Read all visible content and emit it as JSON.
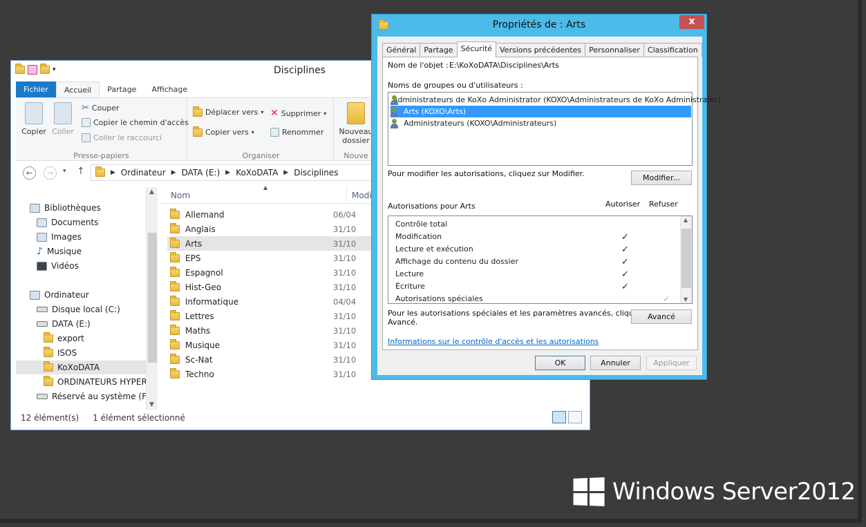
{
  "explorer": {
    "title": "Disciplines",
    "ribbon_tabs": [
      "Fichier",
      "Accueil",
      "Partage",
      "Affichage"
    ],
    "clipboard": {
      "copy": "Copier",
      "paste": "Coller",
      "cut": "Couper",
      "copy_path": "Copier le chemin d'accès",
      "paste_shortcut": "Coller le raccourci",
      "group": "Presse-papiers"
    },
    "organize": {
      "move_to": "Déplacer vers",
      "copy_to": "Copier vers",
      "delete": "Supprimer",
      "rename": "Renommer",
      "group": "Organiser"
    },
    "new": {
      "new_folder_line1": "Nouveau",
      "new_folder_line2": "dossier",
      "group": "Nouve"
    },
    "breadcrumb": [
      "Ordinateur",
      "DATA (E:)",
      "KoXoDATA",
      "Disciplines"
    ],
    "nav": [
      {
        "label": "Bibliothèques",
        "icon": "libraries-icon"
      },
      {
        "label": "Documents",
        "icon": "documents-icon"
      },
      {
        "label": "Images",
        "icon": "pictures-icon"
      },
      {
        "label": "Musique",
        "icon": "music-icon"
      },
      {
        "label": "Vidéos",
        "icon": "videos-icon"
      },
      {
        "label": "Ordinateur",
        "icon": "computer-icon"
      },
      {
        "label": "Disque local (C:)",
        "icon": "drive-icon"
      },
      {
        "label": "DATA (E:)",
        "icon": "drive-icon"
      },
      {
        "label": "export",
        "icon": "folder-icon"
      },
      {
        "label": "ISOS",
        "icon": "folder-icon"
      },
      {
        "label": "KoXoDATA",
        "icon": "folder-icon"
      },
      {
        "label": "ORDINATEURS HYPER-V",
        "icon": "folder-icon"
      },
      {
        "label": "Réservé au système (F:)",
        "icon": "drive-icon"
      }
    ],
    "columns": {
      "name": "Nom",
      "modified": "Modi"
    },
    "files": [
      {
        "name": "Allemand",
        "date": "06/04"
      },
      {
        "name": "Anglais",
        "date": "31/10"
      },
      {
        "name": "Arts",
        "date": "31/10"
      },
      {
        "name": "EPS",
        "date": "31/10"
      },
      {
        "name": "Espagnol",
        "date": "31/10"
      },
      {
        "name": "Hist-Geo",
        "date": "31/10"
      },
      {
        "name": "Informatique",
        "date": "04/04"
      },
      {
        "name": "Lettres",
        "date": "31/10"
      },
      {
        "name": "Maths",
        "date": "31/10"
      },
      {
        "name": "Musique",
        "date": "31/10"
      },
      {
        "name": "Sc-Nat",
        "date": "31/10"
      },
      {
        "name": "Techno",
        "date": "31/10"
      }
    ],
    "status": {
      "count": "12 élément(s)",
      "selected": "1 élément sélectionné"
    }
  },
  "dialog": {
    "title": "Propriétés de : Arts",
    "close": "x",
    "tabs": [
      "Général",
      "Partage",
      "Sécurité",
      "Versions précédentes",
      "Personnaliser",
      "Classification"
    ],
    "object_label": "Nom de l'objet :",
    "object_value": "E:\\KoXoDATA\\Disciplines\\Arts",
    "groups_label": "Noms de groupes ou d'utilisateurs :",
    "users": [
      "Administrateurs de KoXo Administrator (KOXO\\Administrateurs de KoXo Administrator)",
      "Arts (KOXO\\Arts)",
      "Administrateurs (KOXO\\Administrateurs)"
    ],
    "modify_hint": "Pour modifier les autorisations, cliquez sur Modifier.",
    "modify_button": "Modifier...",
    "perms_label": "Autorisations pour Arts",
    "allow_label": "Autoriser",
    "deny_label": "Refuser",
    "permissions": [
      {
        "name": "Contrôle total",
        "allow": "",
        "deny": ""
      },
      {
        "name": "Modification",
        "allow": "✓",
        "deny": ""
      },
      {
        "name": "Lecture et exécution",
        "allow": "✓",
        "deny": ""
      },
      {
        "name": "Affichage du contenu du dossier",
        "allow": "✓",
        "deny": ""
      },
      {
        "name": "Lecture",
        "allow": "✓",
        "deny": ""
      },
      {
        "name": "Écriture",
        "allow": "✓",
        "deny": ""
      },
      {
        "name": "Autorisations spéciales",
        "allow": "",
        "deny": "✓"
      }
    ],
    "advanced_hint_line1": "Pour les autorisations spéciales et les paramètres avancés, cliquez sur",
    "advanced_hint_line2": "Avancé.",
    "advanced_button": "Avancé",
    "link": "Informations sur le contrôle d'accès et les autorisations",
    "ok": "OK",
    "cancel": "Annuler",
    "apply": "Appliquer"
  },
  "brand": {
    "text": "Windows Server",
    "version": "2012"
  }
}
